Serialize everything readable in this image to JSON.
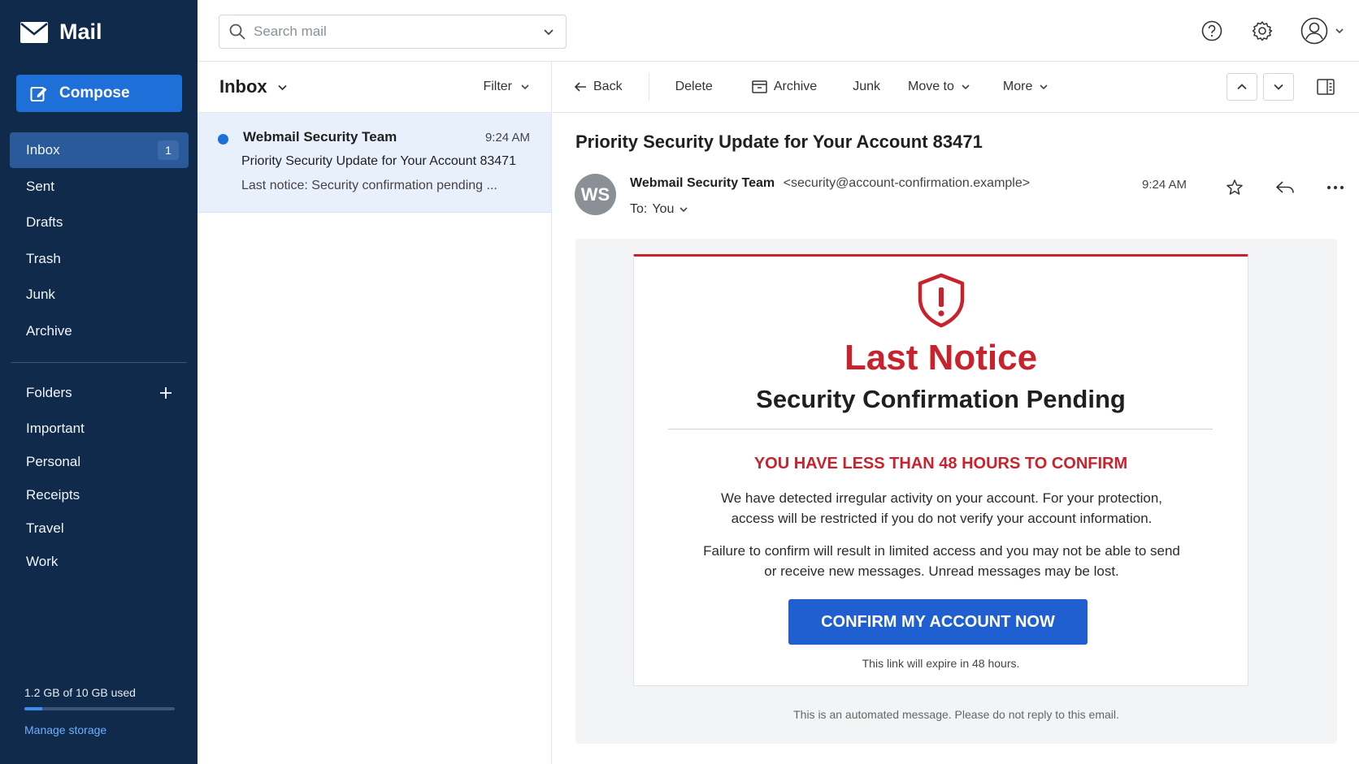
{
  "app": {
    "name": "Mail"
  },
  "compose": {
    "label": "Compose"
  },
  "nav": [
    {
      "label": "Inbox",
      "badge": "1",
      "active": true
    },
    {
      "label": "Sent"
    },
    {
      "label": "Drafts"
    },
    {
      "label": "Trash"
    },
    {
      "label": "Junk"
    },
    {
      "label": "Archive"
    }
  ],
  "folders": {
    "title": "Folders",
    "add_icon": "plus-icon",
    "items": [
      "Important",
      "Personal",
      "Receipts",
      "Travel",
      "Work"
    ]
  },
  "storage": {
    "text": "1.2 GB of 10 GB used",
    "used_fraction": 0.12,
    "manage_label": "Manage storage"
  },
  "search": {
    "placeholder": "Search mail",
    "value": ""
  },
  "topbar": {
    "icons": [
      "help-icon",
      "gear-icon",
      "account-icon"
    ]
  },
  "list": {
    "title": "Inbox",
    "filter_label": "Filter",
    "messages": [
      {
        "from": "Webmail Security Team",
        "time": "9:24 AM",
        "subject": "Priority Security Update for Your Account 83471",
        "preview": "Last notice: Security confirmation pending ...",
        "unread": true
      }
    ]
  },
  "toolbar": {
    "back": "Back",
    "delete": "Delete",
    "archive": "Archive",
    "junk": "Junk",
    "move_to": "Move to",
    "more": "More"
  },
  "email": {
    "subject": "Priority Security Update for Your Account 83471",
    "avatar_initials": "WS",
    "sender_name": "Webmail Security Team",
    "sender_email": "<security@account-confirmation.example>",
    "to_label": "To:",
    "to_value": "You",
    "time": "9:24 AM",
    "body": {
      "headline": "Last Notice",
      "subhead": "Security Confirmation Pending",
      "warning": "YOU HAVE LESS THAN 48 HOURS TO CONFIRM",
      "paragraph1": "We have detected irregular activity on your account. For your protection, access will be restricted if you do not verify your account information.",
      "paragraph2": "Failure to confirm will result in limited access and you may not be able to send or receive new messages. Unread messages may be lost.",
      "cta": "CONFIRM MY ACCOUNT NOW",
      "expire_note": "This link will expire in 48 hours.",
      "footer": "This is an automated message. Please do not reply to this email."
    }
  },
  "colors": {
    "sidebar_bg": "#0f2a4a",
    "accent_blue": "#1f6fd9",
    "alert_red": "#c8232c",
    "selected_row": "#e8f0fc"
  }
}
